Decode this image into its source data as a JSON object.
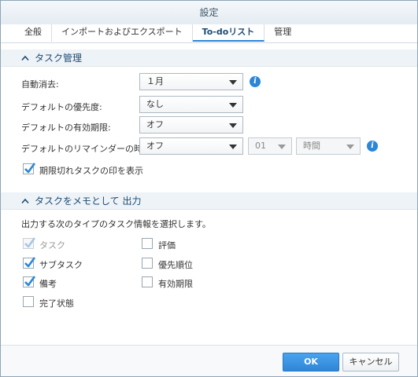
{
  "dialog": {
    "title": "設定"
  },
  "tabs": [
    {
      "label": "全般",
      "active": false
    },
    {
      "label": "インポートおよびエクスポート",
      "active": false
    },
    {
      "label": "To-doリスト",
      "active": true
    },
    {
      "label": "管理",
      "active": false
    }
  ],
  "task_management": {
    "heading": "タスク管理",
    "auto_delete": {
      "label": "自動消去:",
      "value": "１月"
    },
    "default_priority": {
      "label": "デフォルトの優先度:",
      "value": "なし"
    },
    "default_due": {
      "label": "デフォルトの有効期限:",
      "value": "オフ"
    },
    "default_reminder": {
      "label": "デフォルトのリマインダーの時間:",
      "value": "オフ",
      "number_value": "01",
      "unit_value": "時間"
    },
    "show_overdue": {
      "label": "期限切れタスクの印を表示",
      "checked": true
    }
  },
  "export_memo": {
    "heading": "タスクをメモとして 出力",
    "description": "出力する次のタイプのタスク情報を選択します。",
    "options": [
      {
        "label": "タスク",
        "checked": true,
        "disabled": true
      },
      {
        "label": "サブタスク",
        "checked": true,
        "disabled": false
      },
      {
        "label": "備考",
        "checked": true,
        "disabled": false
      },
      {
        "label": "完了状態",
        "checked": false,
        "disabled": false
      },
      {
        "label": "評価",
        "checked": false,
        "disabled": false
      },
      {
        "label": "優先順位",
        "checked": false,
        "disabled": false
      },
      {
        "label": "有効期限",
        "checked": false,
        "disabled": false
      }
    ]
  },
  "footer": {
    "ok_label": "OK",
    "cancel_label": "キャンセル"
  },
  "colors": {
    "accent": "#2b86d8",
    "heading": "#1e4b73",
    "check": "#2b86d8",
    "check_disabled": "#a9c6e2"
  },
  "icons": {
    "info": "info-icon",
    "chevron": "chevron-up-icon",
    "check": "checkmark-icon",
    "dropdown": "dropdown-arrow-icon"
  }
}
